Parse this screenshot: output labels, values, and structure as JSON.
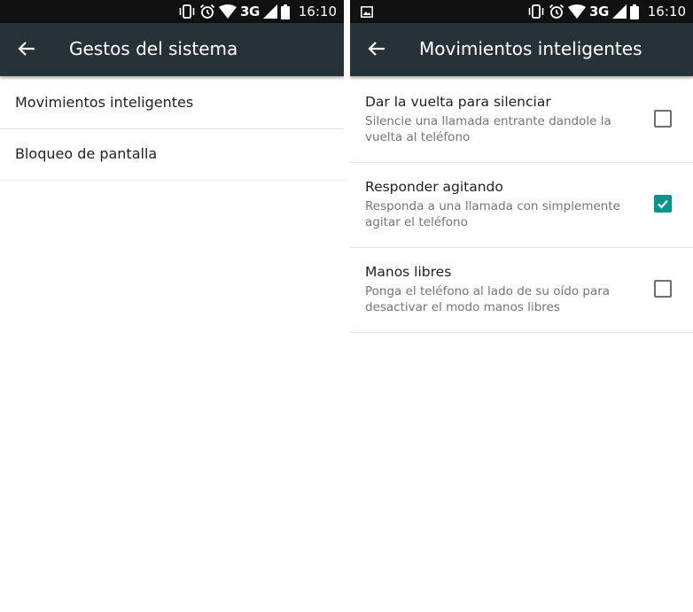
{
  "status_bar": {
    "network": "3G",
    "time": "16:10"
  },
  "colors": {
    "app_bar": "#263238",
    "status_bar": "#111111",
    "accent": "#009688"
  },
  "left_screen": {
    "title": "Gestos del sistema",
    "items": [
      {
        "label": "Movimientos inteligentes"
      },
      {
        "label": "Bloqueo de pantalla"
      }
    ]
  },
  "right_screen": {
    "title": "Movimientos inteligentes",
    "preferences": [
      {
        "title": "Dar la vuelta para silenciar",
        "summary": "Silencie una llamada entrante dandole la vuelta al teléfono",
        "checked": false
      },
      {
        "title": "Responder agitando",
        "summary": "Responda a una llamada con simplemente agitar el teléfono",
        "checked": true
      },
      {
        "title": "Manos libres",
        "summary": "Ponga el teléfono al lado de su oído para desactivar el modo manos libres",
        "checked": false
      }
    ]
  }
}
